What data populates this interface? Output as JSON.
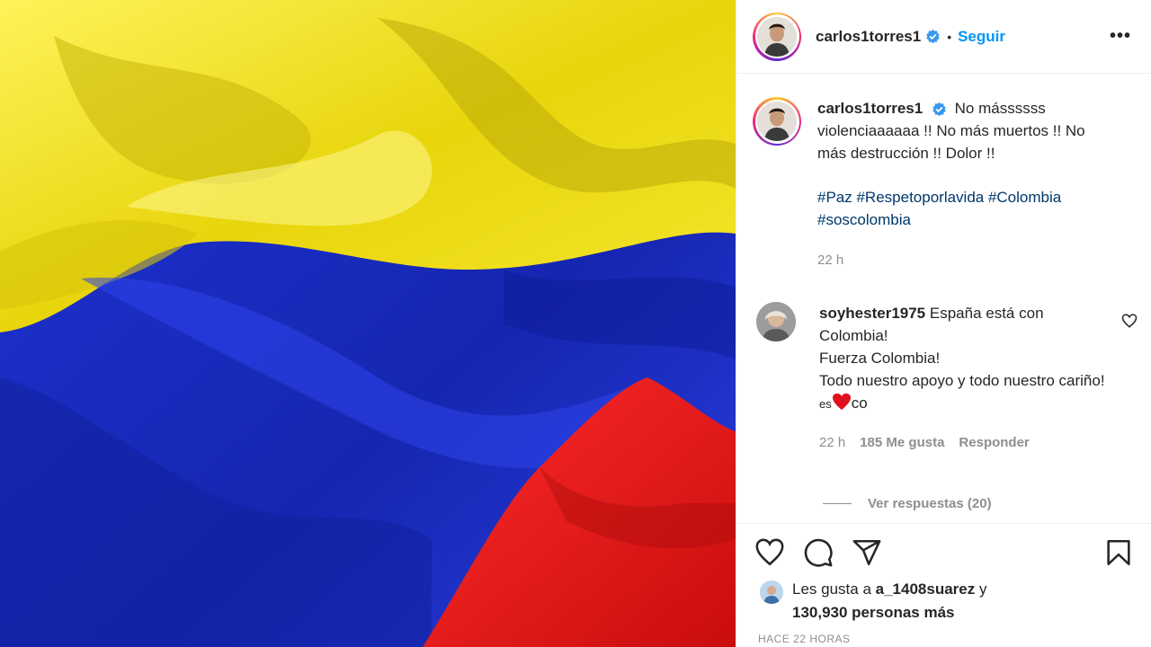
{
  "post": {
    "username": "carlos1torres1",
    "follow_label": "Seguir",
    "more_label": "•••",
    "dot": "•"
  },
  "caption": {
    "username": "carlos1torres1",
    "text": "No mássssss violenciaaaaaa !! No más muertos !! No más destrucción !! Dolor !!",
    "hashtags": "#Paz #Respetoporlavida #Colombia #soscolombia",
    "time": "22 h"
  },
  "comment": {
    "username": "soyhester1975",
    "line1": "España está con",
    "line2": "Colombia!",
    "line3": "Fuerza Colombia!",
    "line4": "Todo nuestro apoyo y todo nuestro cariño!",
    "es": "es",
    "co": "co",
    "time": "22 h",
    "likes": "185 Me gusta",
    "reply": "Responder",
    "view_replies": "Ver respuestas (20)"
  },
  "likes": {
    "prefix": "Les gusta a",
    "user": "a_1408suarez",
    "and": "y",
    "count": "130,930 personas más"
  },
  "ago": "HACE 22 HORAS",
  "colors": {
    "follow": "#0095f6",
    "hashtag": "#00376b",
    "meta": "#8e8e8e",
    "flag_yellow": "#f2e01a",
    "flag_blue": "#1a2fc8",
    "flag_red": "#e01818"
  },
  "icons": [
    "verified-icon",
    "more-icon",
    "heart-icon",
    "comment-icon",
    "share-icon",
    "bookmark-icon"
  ]
}
